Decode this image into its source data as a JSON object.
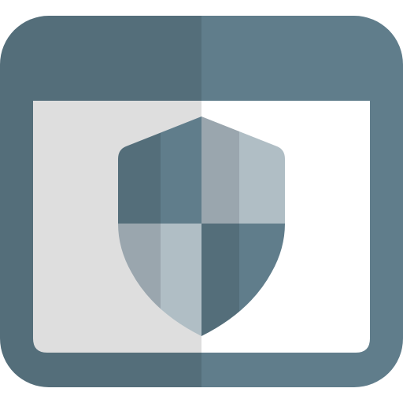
{
  "icon": {
    "name": "browser-security-shield",
    "colors": {
      "frame_dark": "#546E7A",
      "frame_light": "#607D8B",
      "panel_left": "#DEDEDE",
      "panel_right": "#FFFFFF",
      "shield_dark": "#546E7A",
      "shield_mid": "#607D8B",
      "shield_gray": "#9AA6AE",
      "shield_light": "#B0BEC5"
    }
  }
}
